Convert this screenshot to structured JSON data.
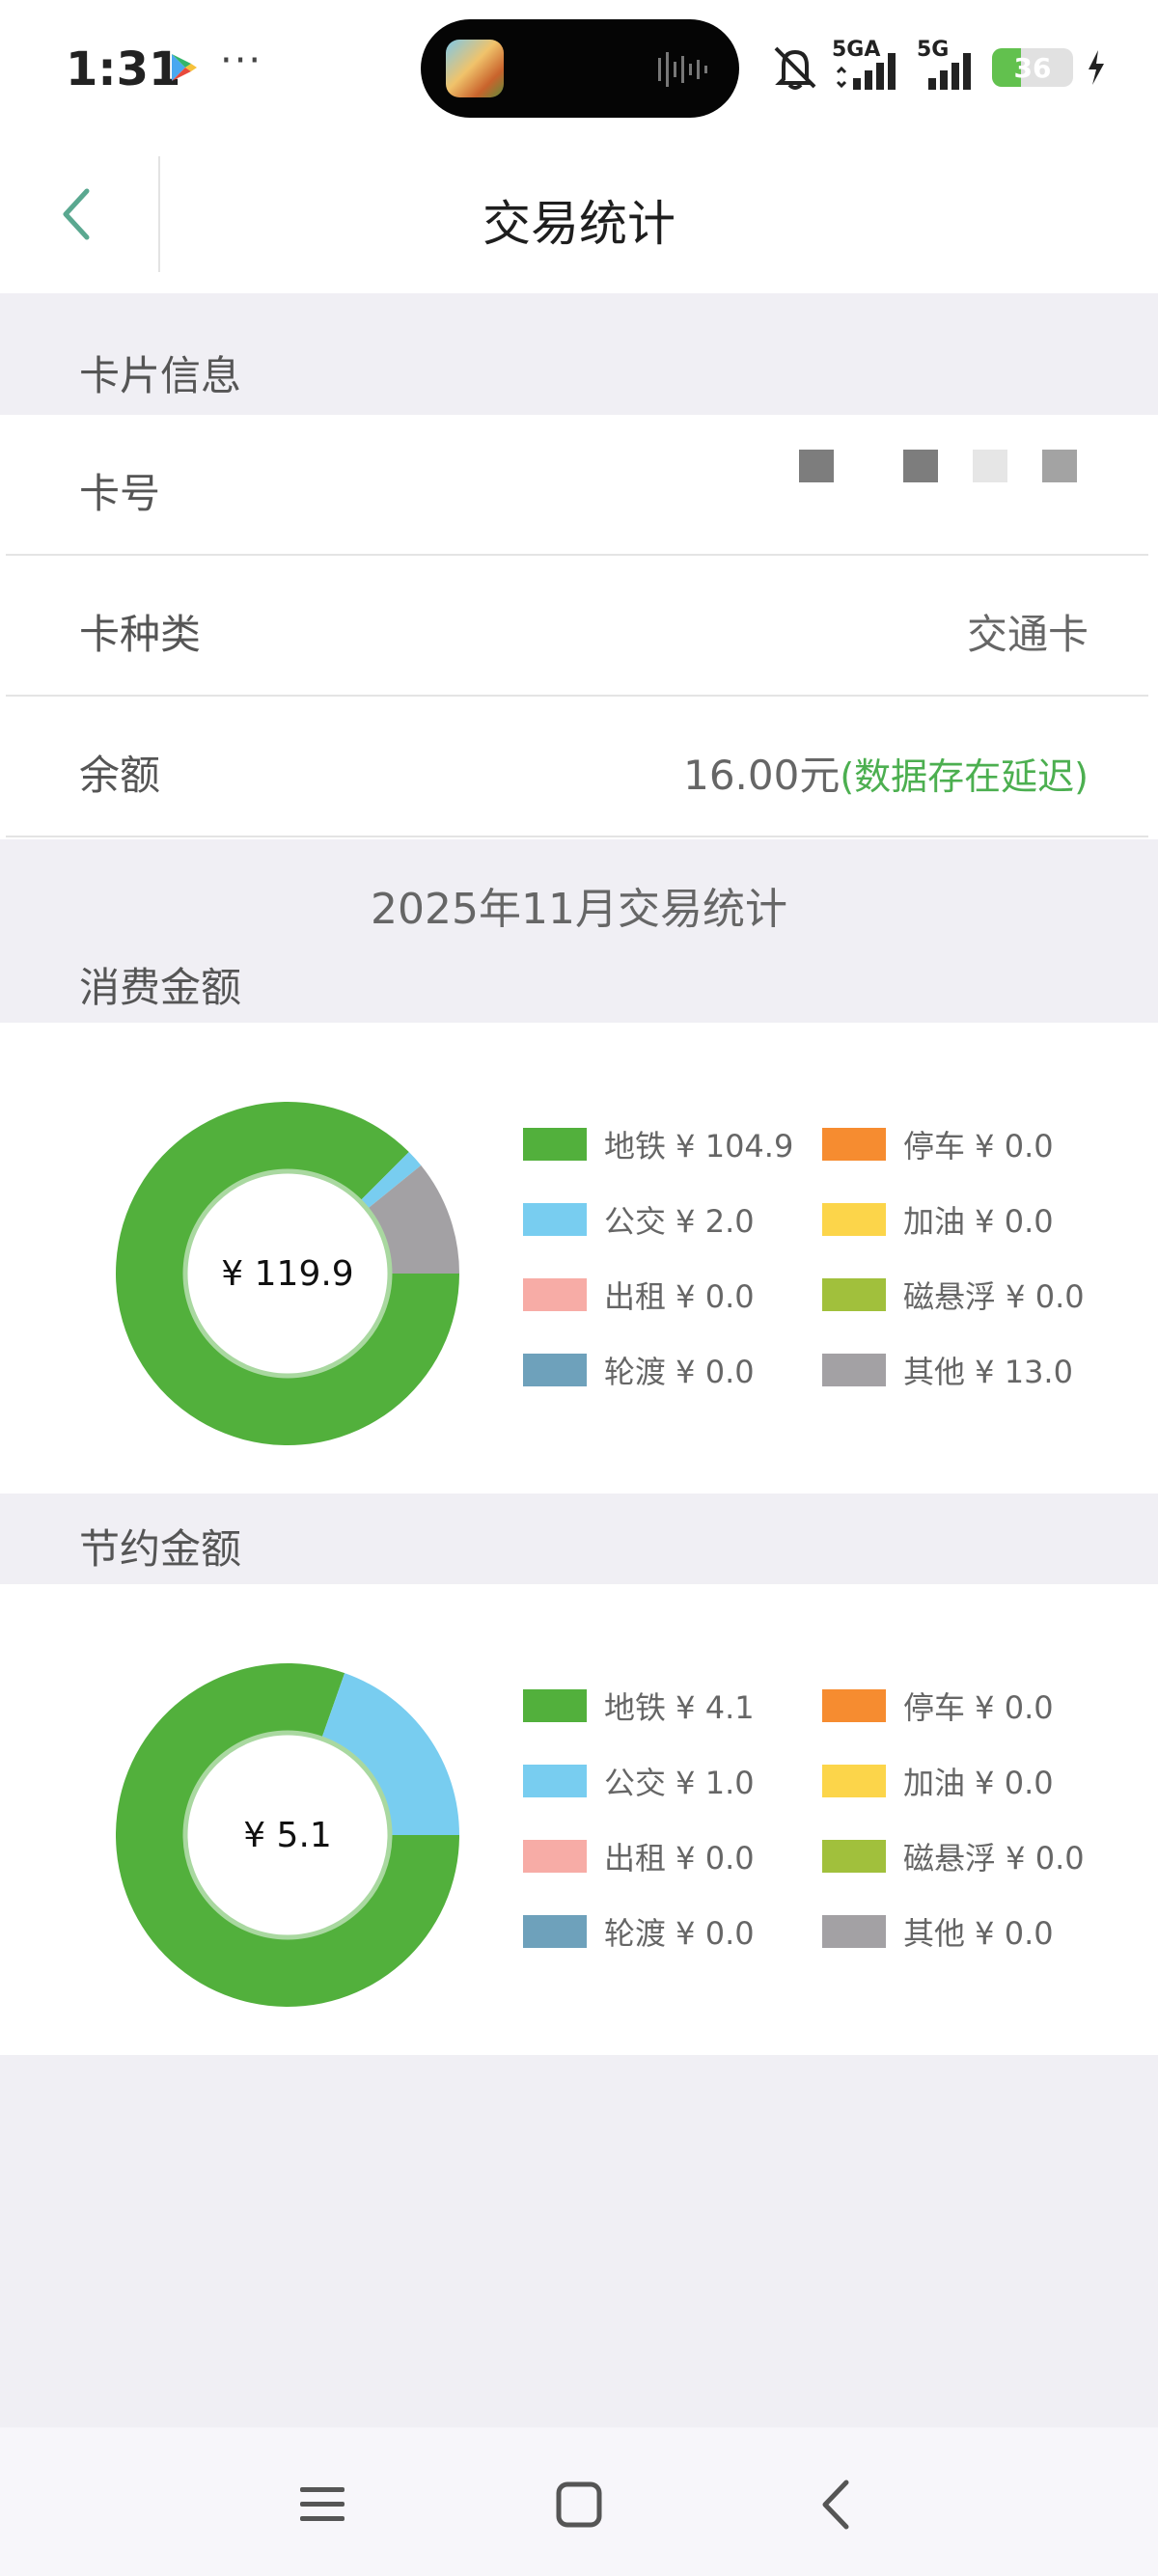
{
  "status_bar": {
    "time": "1:31",
    "more": "···",
    "network1": "5GA",
    "network2": "5G",
    "battery": "36",
    "battery_level": 0.36,
    "icons": [
      "play-store-icon",
      "mute-icon",
      "signal-icon",
      "charging-icon"
    ]
  },
  "header": {
    "title": "交易统计",
    "back_icon": "chevron-left-icon"
  },
  "card_info": {
    "section_title": "卡片信息",
    "rows": [
      {
        "label": "卡号",
        "value": ""
      },
      {
        "label": "卡种类",
        "value": "交通卡"
      },
      {
        "label": "余额",
        "value": "16.00元",
        "note": "(数据存在延迟)"
      }
    ]
  },
  "stats": {
    "month_title": "2025年11月交易统计",
    "consumption": {
      "title": "消费金额",
      "total": "¥ 119.9",
      "legend": [
        {
          "label": "地铁 ¥ 104.9",
          "color": "#52b03c"
        },
        {
          "label": "停车 ¥ 0.0",
          "color": "#f68c30"
        },
        {
          "label": "公交 ¥ 2.0",
          "color": "#78cdf0"
        },
        {
          "label": "加油 ¥ 0.0",
          "color": "#fcd54a"
        },
        {
          "label": "出租 ¥ 0.0",
          "color": "#f7aca6"
        },
        {
          "label": "磁悬浮 ¥ 0.0",
          "color": "#a1c03c"
        },
        {
          "label": "轮渡 ¥ 0.0",
          "color": "#6ea1bb"
        },
        {
          "label": "其他 ¥ 13.0",
          "color": "#a3a1a4"
        }
      ]
    },
    "savings": {
      "title": "节约金额",
      "total": "¥ 5.1",
      "legend": [
        {
          "label": "地铁 ¥ 4.1",
          "color": "#52b03c"
        },
        {
          "label": "停车 ¥ 0.0",
          "color": "#f68c30"
        },
        {
          "label": "公交 ¥ 1.0",
          "color": "#78cdf0"
        },
        {
          "label": "加油 ¥ 0.0",
          "color": "#fcd54a"
        },
        {
          "label": "出租 ¥ 0.0",
          "color": "#f7aca6"
        },
        {
          "label": "磁悬浮 ¥ 0.0",
          "color": "#a1c03c"
        },
        {
          "label": "轮渡 ¥ 0.0",
          "color": "#6ea1bb"
        },
        {
          "label": "其他 ¥ 0.0",
          "color": "#a3a1a4"
        }
      ]
    }
  },
  "chart_data": [
    {
      "type": "pie",
      "categories": [
        "地铁",
        "停车",
        "公交",
        "加油",
        "出租",
        "磁悬浮",
        "轮渡",
        "其他"
      ],
      "values": [
        104.9,
        0.0,
        2.0,
        0.0,
        0.0,
        0.0,
        0.0,
        13.0
      ],
      "colors": [
        "#52b03c",
        "#f68c30",
        "#78cdf0",
        "#fcd54a",
        "#f7aca6",
        "#a1c03c",
        "#6ea1bb",
        "#a3a1a4"
      ],
      "title": "消费金额",
      "center_label": "¥ 119.9",
      "legend_position": "right"
    },
    {
      "type": "pie",
      "categories": [
        "地铁",
        "停车",
        "公交",
        "加油",
        "出租",
        "磁悬浮",
        "轮渡",
        "其他"
      ],
      "values": [
        4.1,
        0.0,
        1.0,
        0.0,
        0.0,
        0.0,
        0.0,
        0.0
      ],
      "colors": [
        "#52b03c",
        "#f68c30",
        "#78cdf0",
        "#fcd54a",
        "#f7aca6",
        "#a1c03c",
        "#6ea1bb",
        "#a3a1a4"
      ],
      "title": "节约金额",
      "center_label": "¥ 5.1",
      "legend_position": "right"
    }
  ],
  "nav_bar": {
    "icons": [
      "menu-icon",
      "home-icon",
      "back-icon"
    ]
  }
}
